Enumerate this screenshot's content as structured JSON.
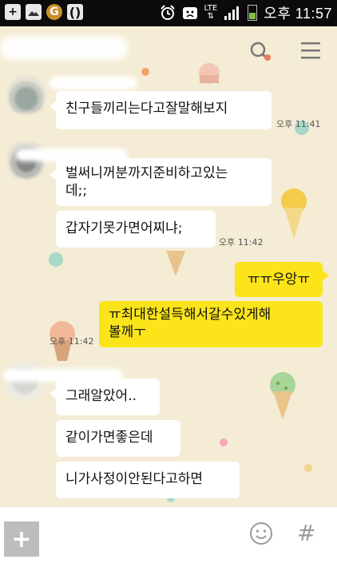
{
  "status_bar": {
    "network": "LTE",
    "time": "오후 11:57"
  },
  "messages": [
    {
      "sender": "friend1",
      "text": "친구들끼리는다고잘말해보지",
      "time": "오후 11:41"
    },
    {
      "sender": "friend2",
      "text": "벌써니꺼분까지준비하고있는\n데;;"
    },
    {
      "sender": "friend2",
      "text": "갑자기못가면어찌냐;",
      "time": "오후 11:42"
    },
    {
      "sender": "me",
      "text": "ㅠㅠ우앙ㅠ"
    },
    {
      "sender": "me",
      "text": "ㅠ최대한설득해서갈수있게해\n볼께ㅜ",
      "time": "오후 11:42"
    },
    {
      "sender": "friend3",
      "text": "그래알았어.."
    },
    {
      "sender": "friend3",
      "text": "같이가면좋은데"
    },
    {
      "sender": "friend3",
      "text": "니가사정이안된다고하면"
    }
  ],
  "icons": {
    "search": "search-icon",
    "menu": "menu-icon",
    "add": "plus-icon",
    "emoticon": "emoticon-icon",
    "hash": "hash-icon"
  },
  "composer": {
    "add_label": "+",
    "hash_label": "#"
  },
  "colors": {
    "background": "#f4ecd5",
    "my_bubble": "#fbe419",
    "friend_bubble": "#ffffff",
    "status_bar": "#0b0b0b"
  }
}
